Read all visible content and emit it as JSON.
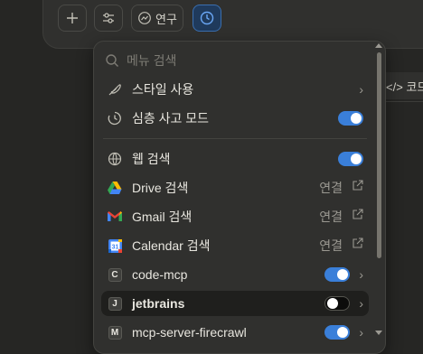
{
  "toolbar": {
    "add_icon": "plus-icon",
    "tools_icon": "sliders-icon",
    "research_label": "연구",
    "research_icon": "trend-icon",
    "clock_icon": "clock-icon"
  },
  "background": {
    "snippet": "</> 코드"
  },
  "menu": {
    "search_placeholder": "메뉴 검색",
    "items": [
      {
        "label": "스타일 사용",
        "icon": "feather-icon",
        "control": "chevron"
      },
      {
        "label": "심층 사고 모드",
        "icon": "clock-icon",
        "control": "toggle",
        "on": true
      },
      {
        "label": "웹 검색",
        "icon": "globe-icon",
        "control": "toggle",
        "on": true
      },
      {
        "label": "Drive 검색",
        "icon": "google-drive-icon",
        "control": "connect",
        "connect_label": "연결"
      },
      {
        "label": "Gmail 검색",
        "icon": "gmail-icon",
        "control": "connect",
        "connect_label": "연결"
      },
      {
        "label": "Calendar 검색",
        "icon": "google-calendar-icon",
        "control": "connect",
        "connect_label": "연결"
      },
      {
        "label": "code-mcp",
        "badge": "C",
        "control": "toggle-chevron",
        "on": true
      },
      {
        "label": "jetbrains",
        "badge": "J",
        "control": "toggle-chevron",
        "on": false,
        "highlighted": true
      },
      {
        "label": "mcp-server-firecrawl",
        "badge": "M",
        "control": "toggle-chevron",
        "on": true
      }
    ]
  },
  "colors": {
    "accent": "#3a7fd9",
    "background": "#262624",
    "menu": "#30302e"
  }
}
